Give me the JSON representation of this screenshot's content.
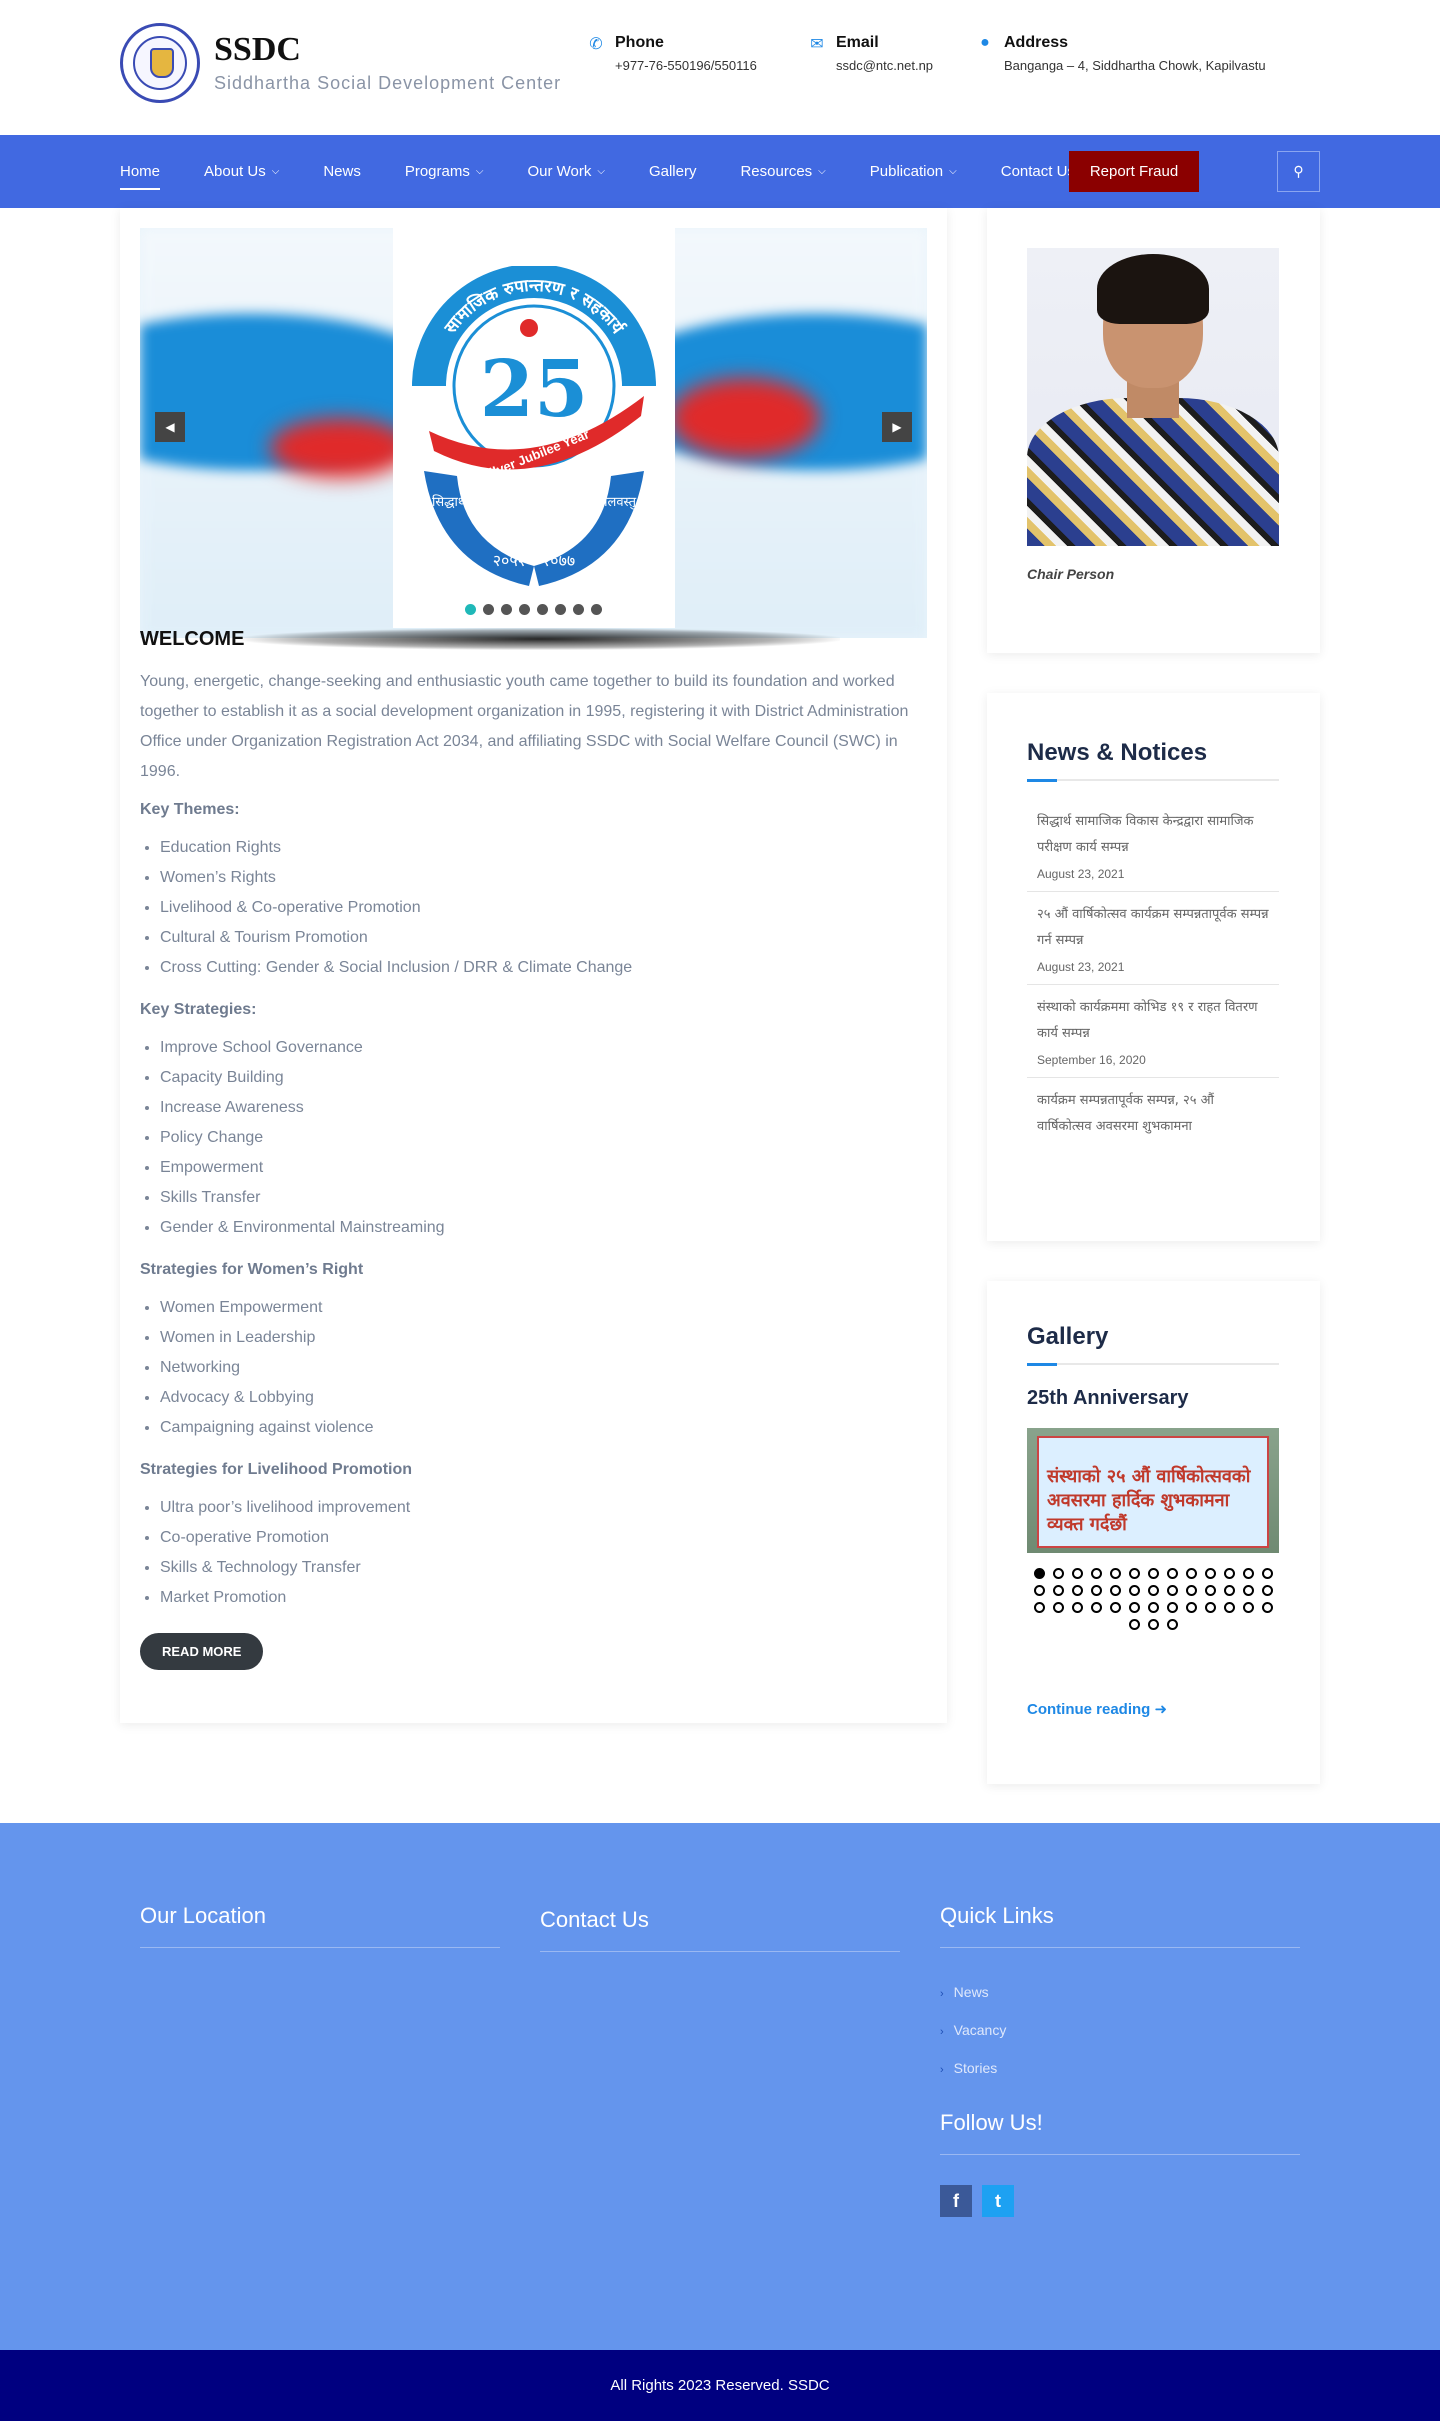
{
  "brand": {
    "title": "SSDC",
    "subtitle": "Siddhartha Social Development Center"
  },
  "contacts": {
    "phone": {
      "label": "Phone",
      "value": "+977-76-550196/550116",
      "icon": "phone-icon"
    },
    "email": {
      "label": "Email",
      "value": "ssdc@ntc.net.np",
      "icon": "envelope-icon"
    },
    "address": {
      "label": "Address",
      "value": "Banganga – 4, Siddhartha Chowk, Kapilvastu",
      "icon": "map-pin-icon"
    }
  },
  "nav": {
    "items": [
      {
        "label": "Home",
        "dropdown": false,
        "active": true
      },
      {
        "label": "About Us",
        "dropdown": true
      },
      {
        "label": "News",
        "dropdown": false
      },
      {
        "label": "Programs",
        "dropdown": true
      },
      {
        "label": "Our Work",
        "dropdown": true
      },
      {
        "label": "Gallery",
        "dropdown": false
      },
      {
        "label": "Resources",
        "dropdown": true
      },
      {
        "label": "Publication",
        "dropdown": true
      },
      {
        "label": "Contact Us",
        "dropdown": false
      }
    ],
    "report_fraud": "Report Fraud",
    "accent": "#4169e1",
    "fraud_color": "#8b0000"
  },
  "slider": {
    "dot_count": 8,
    "active_dot": 0,
    "emblem": {
      "top_text": "सामाजिक रुपान्तरण र सहकार्य",
      "number": "25",
      "ribbon": "Silver Jubilee Year",
      "org": "सिद्धार्थ सामाजिक विकास केन्द्र, कपिलवस्तु",
      "years": "२०५२ - २०७७"
    }
  },
  "welcome": {
    "heading": "WELCOME",
    "paragraph": "Young, energetic, change-seeking and enthusiastic youth came together to build its foundation and worked together to establish it as a social development organization in 1995, registering it with District Administration Office under Organization Registration Act 2034, and affiliating SSDC with Social Welfare Council (SWC) in 1996.",
    "sections": [
      {
        "title": "Key Themes:",
        "items": [
          "Education Rights",
          "Women’s Rights",
          "Livelihood & Co-operative Promotion",
          "Cultural & Tourism Promotion",
          "Cross Cutting: Gender & Social Inclusion / DRR & Climate Change"
        ]
      },
      {
        "title": "Key Strategies:",
        "items": [
          "Improve School Governance",
          "Capacity Building",
          "Increase Awareness",
          "Policy Change",
          "Empowerment",
          "Skills Transfer",
          "Gender & Environmental Mainstreaming"
        ]
      },
      {
        "title": "Strategies for Women’s Right",
        "items": [
          "Women Empowerment",
          "Women in Leadership",
          "Networking",
          "Advocacy & Lobbying",
          "Campaigning against violence"
        ]
      },
      {
        "title": "Strategies for Livelihood Promotion",
        "items": [
          "Ultra poor’s livelihood improvement",
          "Co-operative Promotion",
          "Skills & Technology Transfer",
          "Market Promotion"
        ]
      }
    ],
    "read_more": "READ MORE"
  },
  "chair": {
    "caption": "Chair Person"
  },
  "news": {
    "title": "News & Notices",
    "items": [
      {
        "text": "सिद्धार्थ सामाजिक विकास केन्द्रद्वारा सामाजिक परीक्षण कार्य सम्पन्न",
        "date": "August 23, 2021"
      },
      {
        "text": "२५ औं वार्षिकोत्सव कार्यक्रम सम्पन्नतापूर्वक सम्पन्न गर्न सम्पन्न",
        "date": "August 23, 2021"
      },
      {
        "text": "संस्थाको कार्यक्रममा कोभिड १९ र राहत वितरण कार्य सम्पन्न",
        "date": "September 16, 2020"
      },
      {
        "text": "कार्यक्रम सम्पन्नतापूर्वक सम्पन्न, २५ औं वार्षिकोत्सव अवसरमा शुभकामना",
        "date": ""
      }
    ]
  },
  "gallery": {
    "title": "Gallery",
    "album": "25th Anniversary",
    "banner_text": "संस्थाको २५ औं वार्षिकोत्सवको अवसरमा हार्दिक शुभकामना व्यक्त गर्दछौं",
    "dot_count": 42,
    "active_dot": 0,
    "continue": "Continue reading"
  },
  "footer": {
    "location_title": "Our Location",
    "contact_title": "Contact Us",
    "quick_title": "Quick Links",
    "links": [
      "News",
      "Vacancy",
      "Stories"
    ],
    "follow_title": "Follow Us!",
    "social": [
      {
        "icon": "facebook-icon",
        "glyph": "f"
      },
      {
        "icon": "twitter-icon",
        "glyph": "t"
      }
    ],
    "copyright": "All Rights 2023 Reserved. SSDC",
    "bg": "#6495ed",
    "copy_bg": "#000080"
  }
}
